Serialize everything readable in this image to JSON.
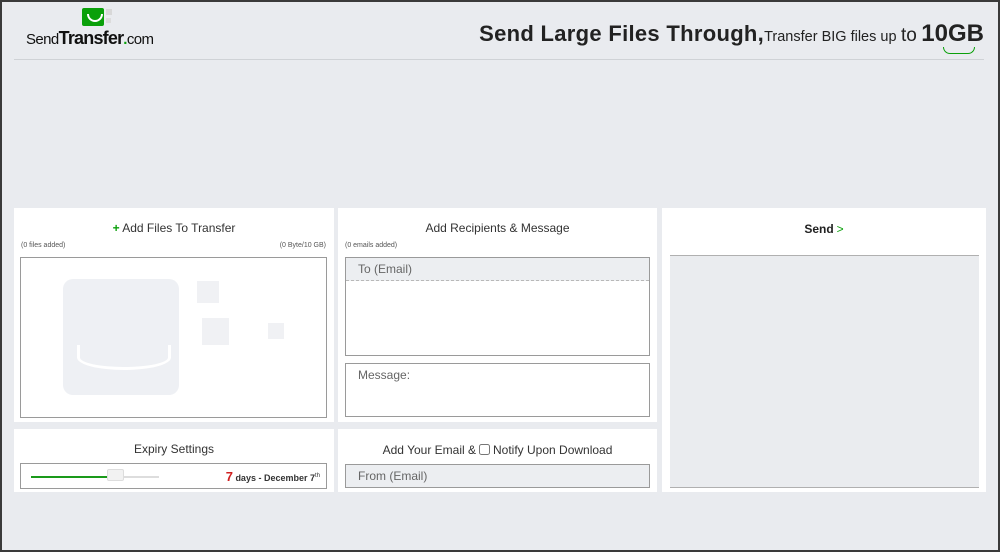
{
  "header": {
    "logo": {
      "part1": "Send",
      "part2": "Transfer",
      "dot": ".",
      "part3": "com"
    },
    "tagline": {
      "main": "Send Large Files Through,",
      "sub": "Transfer BIG files up",
      "to": "to",
      "size": "10GB"
    }
  },
  "files": {
    "add_icon": "+",
    "title": "Add Files To Transfer",
    "count": "(0 files added)",
    "size": "(0 Byte/10 GB)"
  },
  "recipients": {
    "title": "Add Recipients & Message",
    "count": "(0 emails added)",
    "to_placeholder": "To (Email)",
    "message_placeholder": "Message:"
  },
  "send": {
    "label": "Send",
    "chevron": ">"
  },
  "expiry": {
    "title": "Expiry Settings",
    "days": "7",
    "days_label": "days - December 7",
    "suffix": "th",
    "slider_fraction": 0.6
  },
  "email": {
    "title": "Add Your Email &",
    "notify_label": "Notify Upon Download",
    "notify_checked": false,
    "from_placeholder": "From (Email)"
  },
  "colors": {
    "accent": "#0aa00a",
    "days": "#d02020",
    "background": "#e9ebef"
  }
}
